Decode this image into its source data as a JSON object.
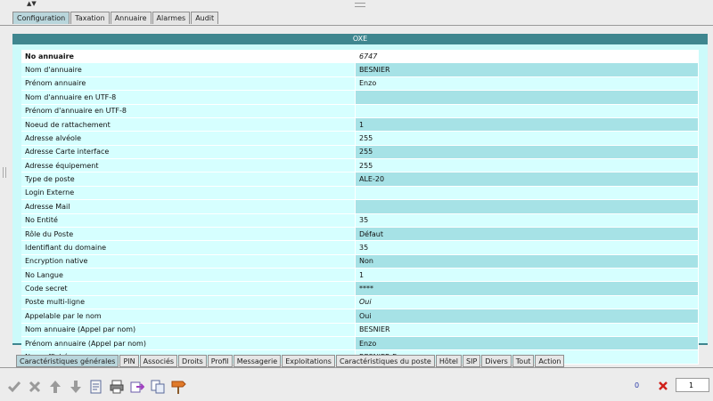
{
  "top_tabs": [
    "Configuration",
    "Taxation",
    "Annuaire",
    "Alarmes",
    "Audit"
  ],
  "panel_title": "OXE",
  "rows": [
    {
      "label": "No annuaire",
      "value": "6747"
    },
    {
      "label": "Nom d'annuaire",
      "value": "BESNIER"
    },
    {
      "label": "Prénom annuaire",
      "value": "Enzo"
    },
    {
      "label": "Nom d'annuaire en UTF-8",
      "value": ""
    },
    {
      "label": "Prénom d'annuaire en UTF-8",
      "value": ""
    },
    {
      "label": "Noeud de rattachement",
      "value": "1"
    },
    {
      "label": "Adresse alvéole",
      "value": "255"
    },
    {
      "label": "Adresse Carte interface",
      "value": "255"
    },
    {
      "label": "Adresse équipement",
      "value": "255"
    },
    {
      "label": "Type de poste",
      "value": "ALE-20"
    },
    {
      "label": "Login Externe",
      "value": ""
    },
    {
      "label": "Adresse Mail",
      "value": ""
    },
    {
      "label": "No Entité",
      "value": "35"
    },
    {
      "label": "Rôle du Poste",
      "value": "Défaut"
    },
    {
      "label": "Identifiant du domaine",
      "value": "35"
    },
    {
      "label": "Encryption native",
      "value": "Non"
    },
    {
      "label": "No Langue",
      "value": "1"
    },
    {
      "label": "Code secret",
      "value": "****"
    },
    {
      "label": "Poste multi-ligne",
      "value": "Oui"
    },
    {
      "label": "Appelable par le nom",
      "value": "Oui"
    },
    {
      "label": "Nom annuaire (Appel par nom)",
      "value": "BESNIER"
    },
    {
      "label": "Prénom annuaire (Appel par nom)",
      "value": "Enzo"
    },
    {
      "label": "Nom affiché",
      "value": "BESNIER Enzo"
    }
  ],
  "bottom_tabs": [
    "Caractéristiques générales",
    "PIN",
    "Associés",
    "Droits",
    "Profil",
    "Messagerie",
    "Exploitations",
    "Caractéristiques du poste",
    "Hôtel",
    "SIP",
    "Divers",
    "Tout",
    "Action"
  ],
  "footer": {
    "count": "0",
    "page": "1"
  }
}
